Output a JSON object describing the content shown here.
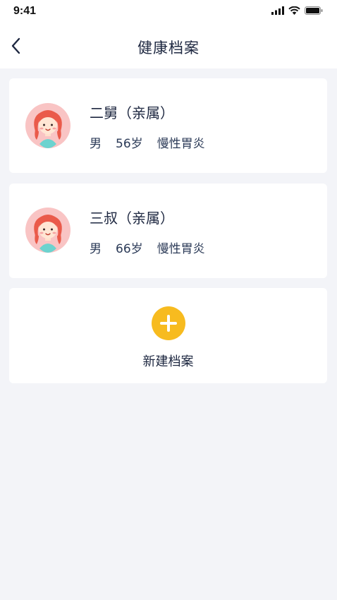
{
  "status_bar": {
    "time": "9:41"
  },
  "nav": {
    "title": "健康档案"
  },
  "profiles": [
    {
      "name": "二舅（亲属）",
      "gender": "男",
      "age": "56岁",
      "condition": "慢性胃炎"
    },
    {
      "name": "三叔（亲属）",
      "gender": "男",
      "age": "66岁",
      "condition": "慢性胃炎"
    }
  ],
  "add_card": {
    "label": "新建档案",
    "icon": "plus-icon"
  },
  "colors": {
    "accent": "#f7bb1f",
    "background": "#f3f4f8",
    "text": "#1d2740"
  }
}
